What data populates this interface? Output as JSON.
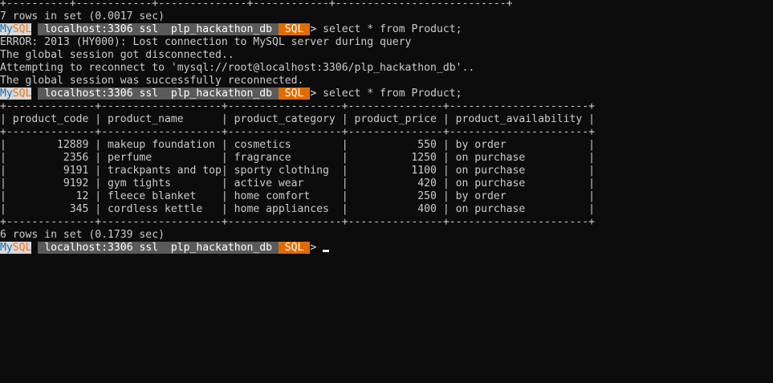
{
  "terminal": {
    "lines": [
      {
        "kind": "text",
        "text": "+----------+------------+--------------+------------+---------------------------+"
      },
      {
        "kind": "text",
        "text": "7 rows in set (0.0017 sec)"
      },
      {
        "kind": "prompt",
        "command": "select * from Product;"
      },
      {
        "kind": "text",
        "text": "ERROR: 2013 (HY000): Lost connection to MySQL server during query"
      },
      {
        "kind": "text",
        "text": "The global session got disconnected.."
      },
      {
        "kind": "text",
        "text": "Attempting to reconnect to 'mysql://root@localhost:3306/plp_hackathon_db'.."
      },
      {
        "kind": "text",
        "text": "The global session was successfully reconnected."
      },
      {
        "kind": "prompt",
        "command": "select * from Product;"
      },
      {
        "kind": "text",
        "text": "+--------------+-------------------+------------------+---------------+----------------------+"
      },
      {
        "kind": "text",
        "text": "| product_code | product_name      | product_category | product_price | product_availability |"
      },
      {
        "kind": "text",
        "text": "+--------------+-------------------+------------------+---------------+----------------------+"
      },
      {
        "kind": "text",
        "text": "|        12889 | makeup foundation | cosmetics        |           550 | by order             |"
      },
      {
        "kind": "text",
        "text": "|         2356 | perfume           | fragrance        |          1250 | on purchase          |"
      },
      {
        "kind": "text",
        "text": "|         9191 | trackpants and top| sporty clothing  |          1100 | on purchase          |"
      },
      {
        "kind": "text",
        "text": "|         9192 | gym tights        | active wear      |           420 | on purchase          |"
      },
      {
        "kind": "text",
        "text": "|           12 | fleece blanket    | home comfort     |           250 | by order             |"
      },
      {
        "kind": "text",
        "text": "|          345 | cordless kettle   | home appliances  |           400 | on purchase          |"
      },
      {
        "kind": "text",
        "text": "+--------------+-------------------+------------------+---------------+----------------------+"
      },
      {
        "kind": "text",
        "text": "6 rows in set (0.1739 sec)"
      },
      {
        "kind": "prompt",
        "command": "",
        "cursor": true
      }
    ]
  },
  "prompt": {
    "mysql_pre": "My",
    "mysql_post": "SQL",
    "host": " localhost:3306 ssl ",
    "db": " plp_hackathon_db ",
    "mode": " SQL ",
    "arrow": "> "
  },
  "colors": {
    "background": "#0c0c0c",
    "text": "#cccccc",
    "mysql_badge": "#d9d9d9",
    "host_badge": "#5a5a5a",
    "mode_badge": "#e06c00"
  }
}
